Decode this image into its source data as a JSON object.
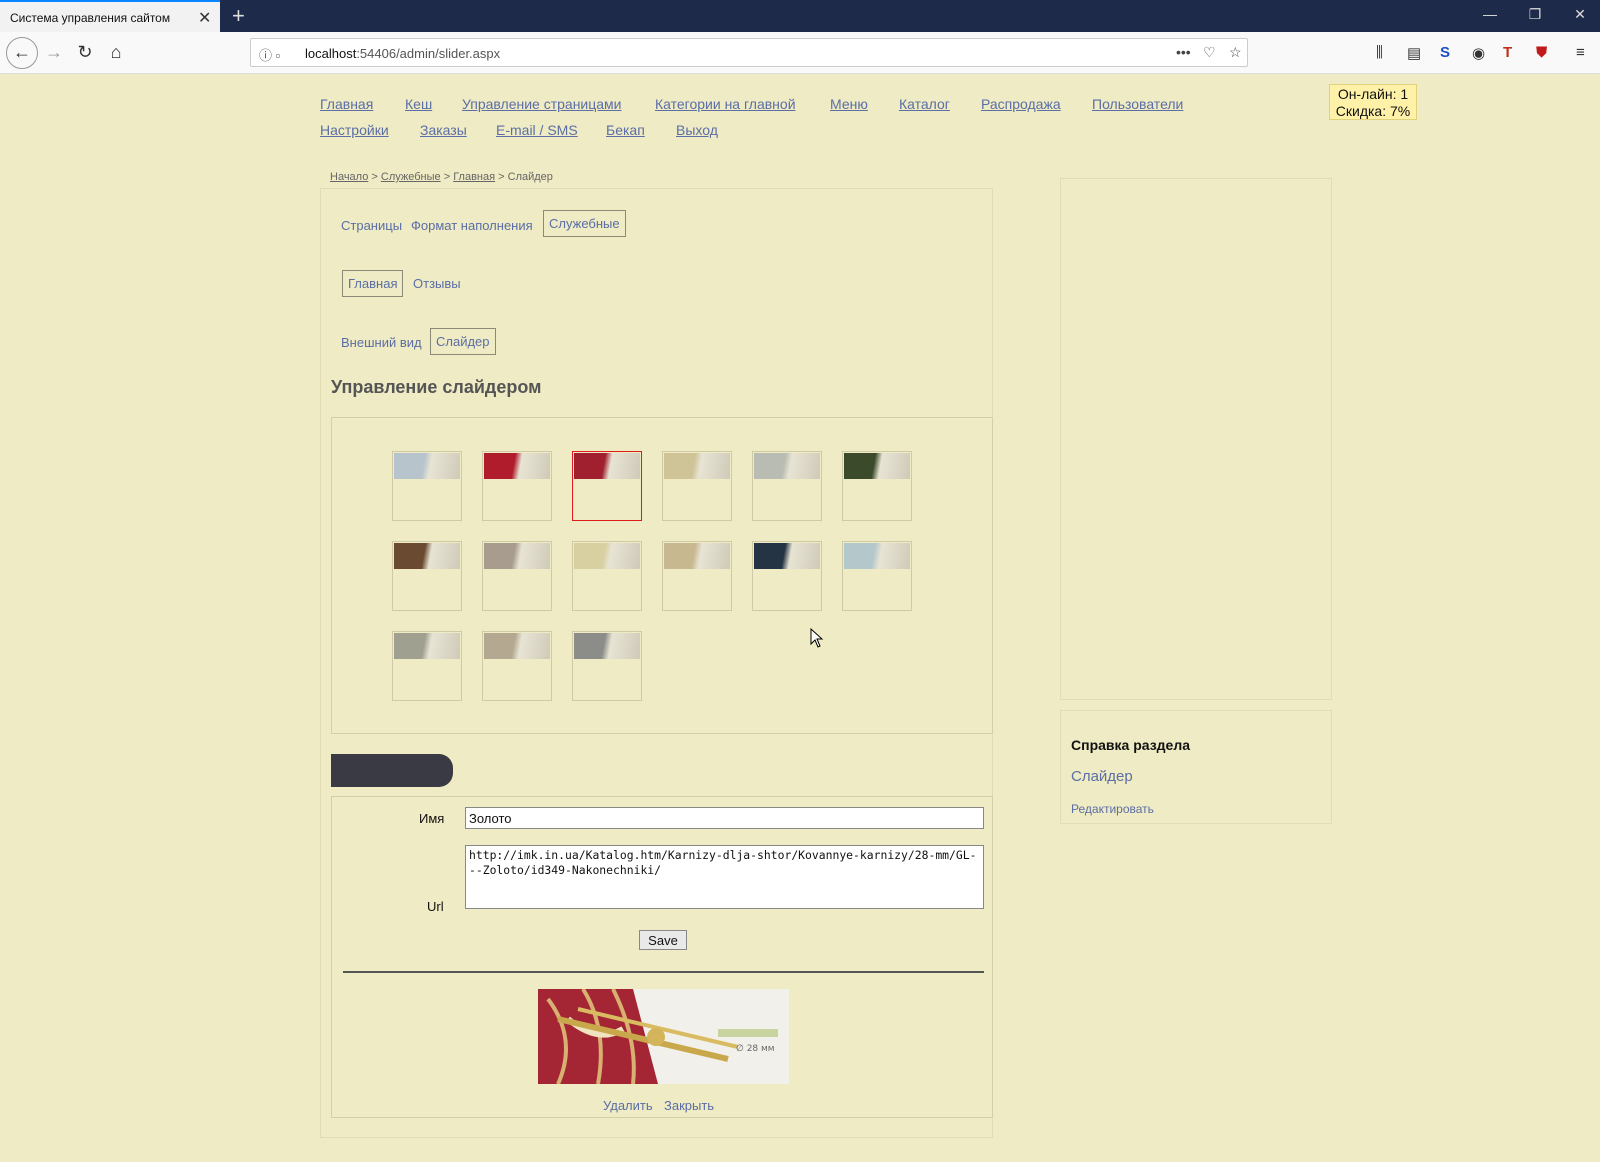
{
  "browser": {
    "tab_title": "Система управления сайтом",
    "url_host": "localhost",
    "url_rest": ":54406/admin/slider.aspx"
  },
  "topnav": {
    "row1": [
      "Главная",
      "Кеш",
      "Управление страницами",
      "Категории на главной",
      "Меню",
      "Каталог",
      "Распродажа",
      "Пользователи"
    ],
    "row2": [
      "Настройки",
      "Заказы",
      "E-mail / SMS",
      "Бекап",
      "Выход"
    ]
  },
  "status": {
    "online": "Он-лайн: 1",
    "discount": "Скидка: 7%"
  },
  "breadcrumb": {
    "items": [
      "Начало",
      "Служебные",
      "Главная"
    ],
    "current": "Слайдер",
    "separator": ">"
  },
  "tabs": {
    "level1": [
      "Страницы",
      "Формат наполнения",
      "Служебные"
    ],
    "level2": [
      "Главная",
      "Отзывы"
    ],
    "level3": [
      "Внешний вид",
      "Слайдер"
    ],
    "active": [
      "Служебные",
      "Главная",
      "Слайдер"
    ]
  },
  "section_title": "Управление слайдером",
  "gallery": {
    "count": 15,
    "selected_index": 2,
    "colors": [
      "#b8c4cc",
      "#b01c2c",
      "#a02030",
      "#cfc398",
      "#b9bcb2",
      "#3a4a2a",
      "#6a4a30",
      "#a89c8e",
      "#d8d0a0",
      "#c8b890",
      "#243444",
      "#b4c8cc",
      "#a0a090",
      "#b4a890",
      "#8c8c88"
    ]
  },
  "form": {
    "name_label": "Имя",
    "name_value": "Золото",
    "url_label": "Url",
    "url_value": "http://imk.in.ua/Katalog.htm/Karnizy-dlja-shtor/Kovannye-karnizy/28-mm/GL---Zoloto/id349-Nakonechniki/",
    "save_label": "Save",
    "delete_label": "Удалить",
    "close_label": "Закрыть"
  },
  "help": {
    "title": "Справка раздела",
    "link": "Слайдер",
    "edit": "Редактировать"
  }
}
